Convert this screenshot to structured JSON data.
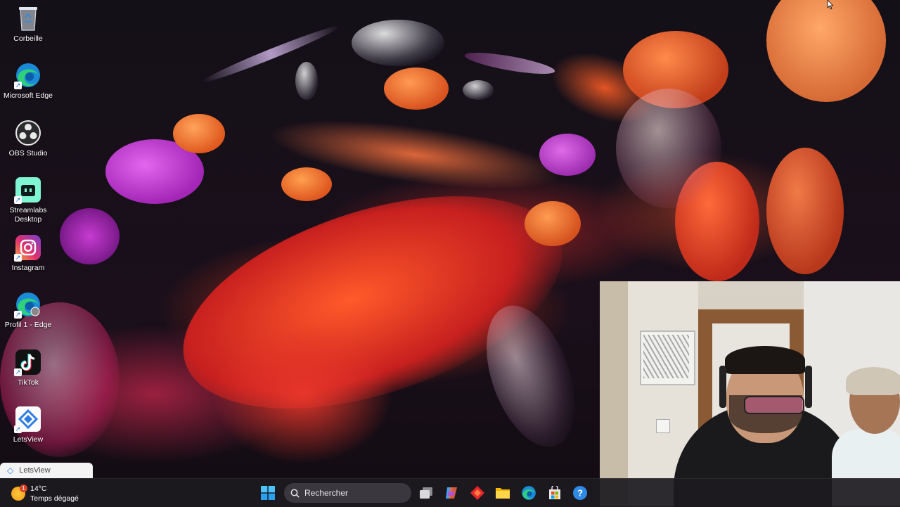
{
  "desktop": {
    "icons": [
      {
        "label": "Corbeille",
        "icon": "recycle-bin-icon"
      },
      {
        "label": "Microsoft Edge",
        "icon": "edge-icon"
      },
      {
        "label": "OBS Studio",
        "icon": "obs-icon"
      },
      {
        "label": "Streamlabs Desktop",
        "icon": "streamlabs-icon"
      },
      {
        "label": "Instagram",
        "icon": "instagram-icon"
      },
      {
        "label": "Profil 1 - Edge",
        "icon": "edge-profile-icon"
      },
      {
        "label": "TikTok",
        "icon": "tiktok-icon"
      },
      {
        "label": "LetsView",
        "icon": "letsview-icon"
      }
    ],
    "popup_label": "LetsView"
  },
  "taskbar": {
    "weather": {
      "badge": "1",
      "temp": "14°C",
      "condition": "Temps dégagé"
    },
    "search_placeholder": "Rechercher",
    "apps": [
      {
        "icon": "windows-start-icon"
      },
      {
        "icon": "task-view-icon"
      },
      {
        "icon": "copilot-icon"
      },
      {
        "icon": "red-app-icon"
      },
      {
        "icon": "file-explorer-icon"
      },
      {
        "icon": "edge-taskbar-icon"
      },
      {
        "icon": "store-icon"
      },
      {
        "icon": "help-icon"
      }
    ]
  },
  "colors": {
    "taskbar_bg": "#1c1a20",
    "search_bg": "#3a373e",
    "wallpaper_orange": "#e8622a",
    "wallpaper_magenta": "#b93ac9"
  }
}
